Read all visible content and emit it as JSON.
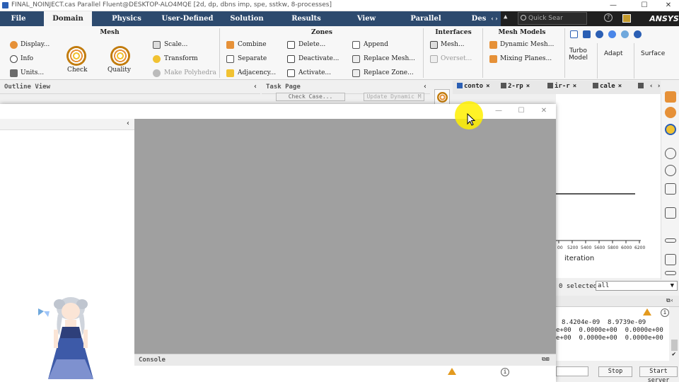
{
  "window": {
    "title": "FINAL_NOINJECT.cas Parallel Fluent@DESKTOP-ALO4MQE  [2d, dp, dbns imp, spe, sstkw, 8-processes]",
    "minimize": "—",
    "maximize": "☐",
    "close": "✕"
  },
  "menu": {
    "tabs": [
      "File",
      "Domain",
      "Physics",
      "User-Defined",
      "Solution",
      "Results",
      "View",
      "Parallel",
      "Des"
    ],
    "active": "Domain",
    "nav_arrows": "‹ ›",
    "up_arrow": "▲",
    "search_placeholder": "Quick Sear",
    "help": "?",
    "logo": "ANSYS"
  },
  "ribbon": {
    "mesh": {
      "title": "Mesh",
      "display": "Display...",
      "info": "Info",
      "units": "Units...",
      "check": "Check",
      "quality": "Quality",
      "scale": "Scale...",
      "transform": "Transform",
      "make_polyhedra": "Make Polyhedra"
    },
    "zones": {
      "title": "Zones",
      "combine": "Combine",
      "separate": "Separate",
      "adjacency": "Adjacency...",
      "delete": "Delete...",
      "deactivate": "Deactivate...",
      "activate": "Activate...",
      "append": "Append",
      "replace_mesh": "Replace Mesh...",
      "replace_zone": "Replace Zone..."
    },
    "interfaces": {
      "title": "Interfaces",
      "mesh": "Mesh...",
      "overset": "Overset..."
    },
    "mesh_models": {
      "title": "Mesh Models",
      "dynamic_mesh": "Dynamic Mesh...",
      "mixing_planes": "Mixing Planes..."
    },
    "turbo": {
      "turbo_model": "Turbo\nModel",
      "adapt": "Adapt",
      "surface": "Surface"
    }
  },
  "outline": {
    "title": "Outline View",
    "collapse": "‹"
  },
  "task_page": {
    "title": "Task Page",
    "check_case": "Check Case...",
    "update_dynamic": "Update Dynamic M",
    "collapse": "‹"
  },
  "graphics_tabs": [
    {
      "label": "conto"
    },
    {
      "label": "2-rp"
    },
    {
      "label": "ir-r"
    },
    {
      "label": "cale"
    },
    {
      "label": ""
    }
  ],
  "graphics_tab_overflow": "‹ ›",
  "plot": {
    "ticks": [
      "00",
      "5200",
      "5400",
      "5600",
      "5800",
      "6000",
      "6200"
    ],
    "xlabel": "iteration"
  },
  "selection": {
    "text": "0 selected",
    "dropdown": "all"
  },
  "residuals": {
    "row1": [
      "8.4204e-09",
      "8.9739e-09"
    ],
    "row2": [
      "e+00",
      "0.0000e+00",
      "0.0000e+00"
    ],
    "row3": [
      "e+00",
      "0.0000e+00",
      "0.0000e+00"
    ],
    "check": "✔"
  },
  "bottom": {
    "stop": "Stop",
    "start_server": "Start server"
  },
  "floating_window": {
    "minimize": "—",
    "maximize": "☐",
    "close": "✕",
    "left_collapse": "‹",
    "console_title": "Console"
  }
}
